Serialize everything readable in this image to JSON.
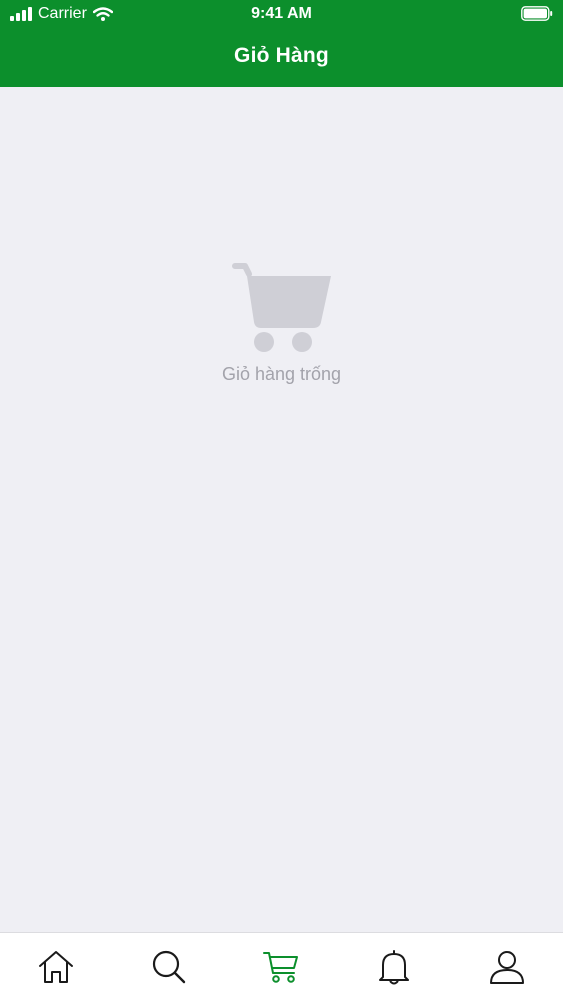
{
  "status_bar": {
    "carrier": "Carrier",
    "time": "9:41 AM"
  },
  "header": {
    "title": "Giỏ Hàng"
  },
  "empty_state": {
    "icon": "cart-icon",
    "message": "Giỏ hàng trống"
  },
  "tab_bar": {
    "items": [
      {
        "icon": "home-icon",
        "active": false
      },
      {
        "icon": "search-icon",
        "active": false
      },
      {
        "icon": "cart-icon",
        "active": true
      },
      {
        "icon": "bell-icon",
        "active": false
      },
      {
        "icon": "user-icon",
        "active": false
      }
    ]
  },
  "colors": {
    "header_bg": "#0c8f2c",
    "active_tab": "#0c8f2c",
    "inactive_tab": "#1a1a1a",
    "empty_icon": "#cfcfd6",
    "empty_text": "#a3a3ab",
    "page_bg": "#efeff4"
  }
}
